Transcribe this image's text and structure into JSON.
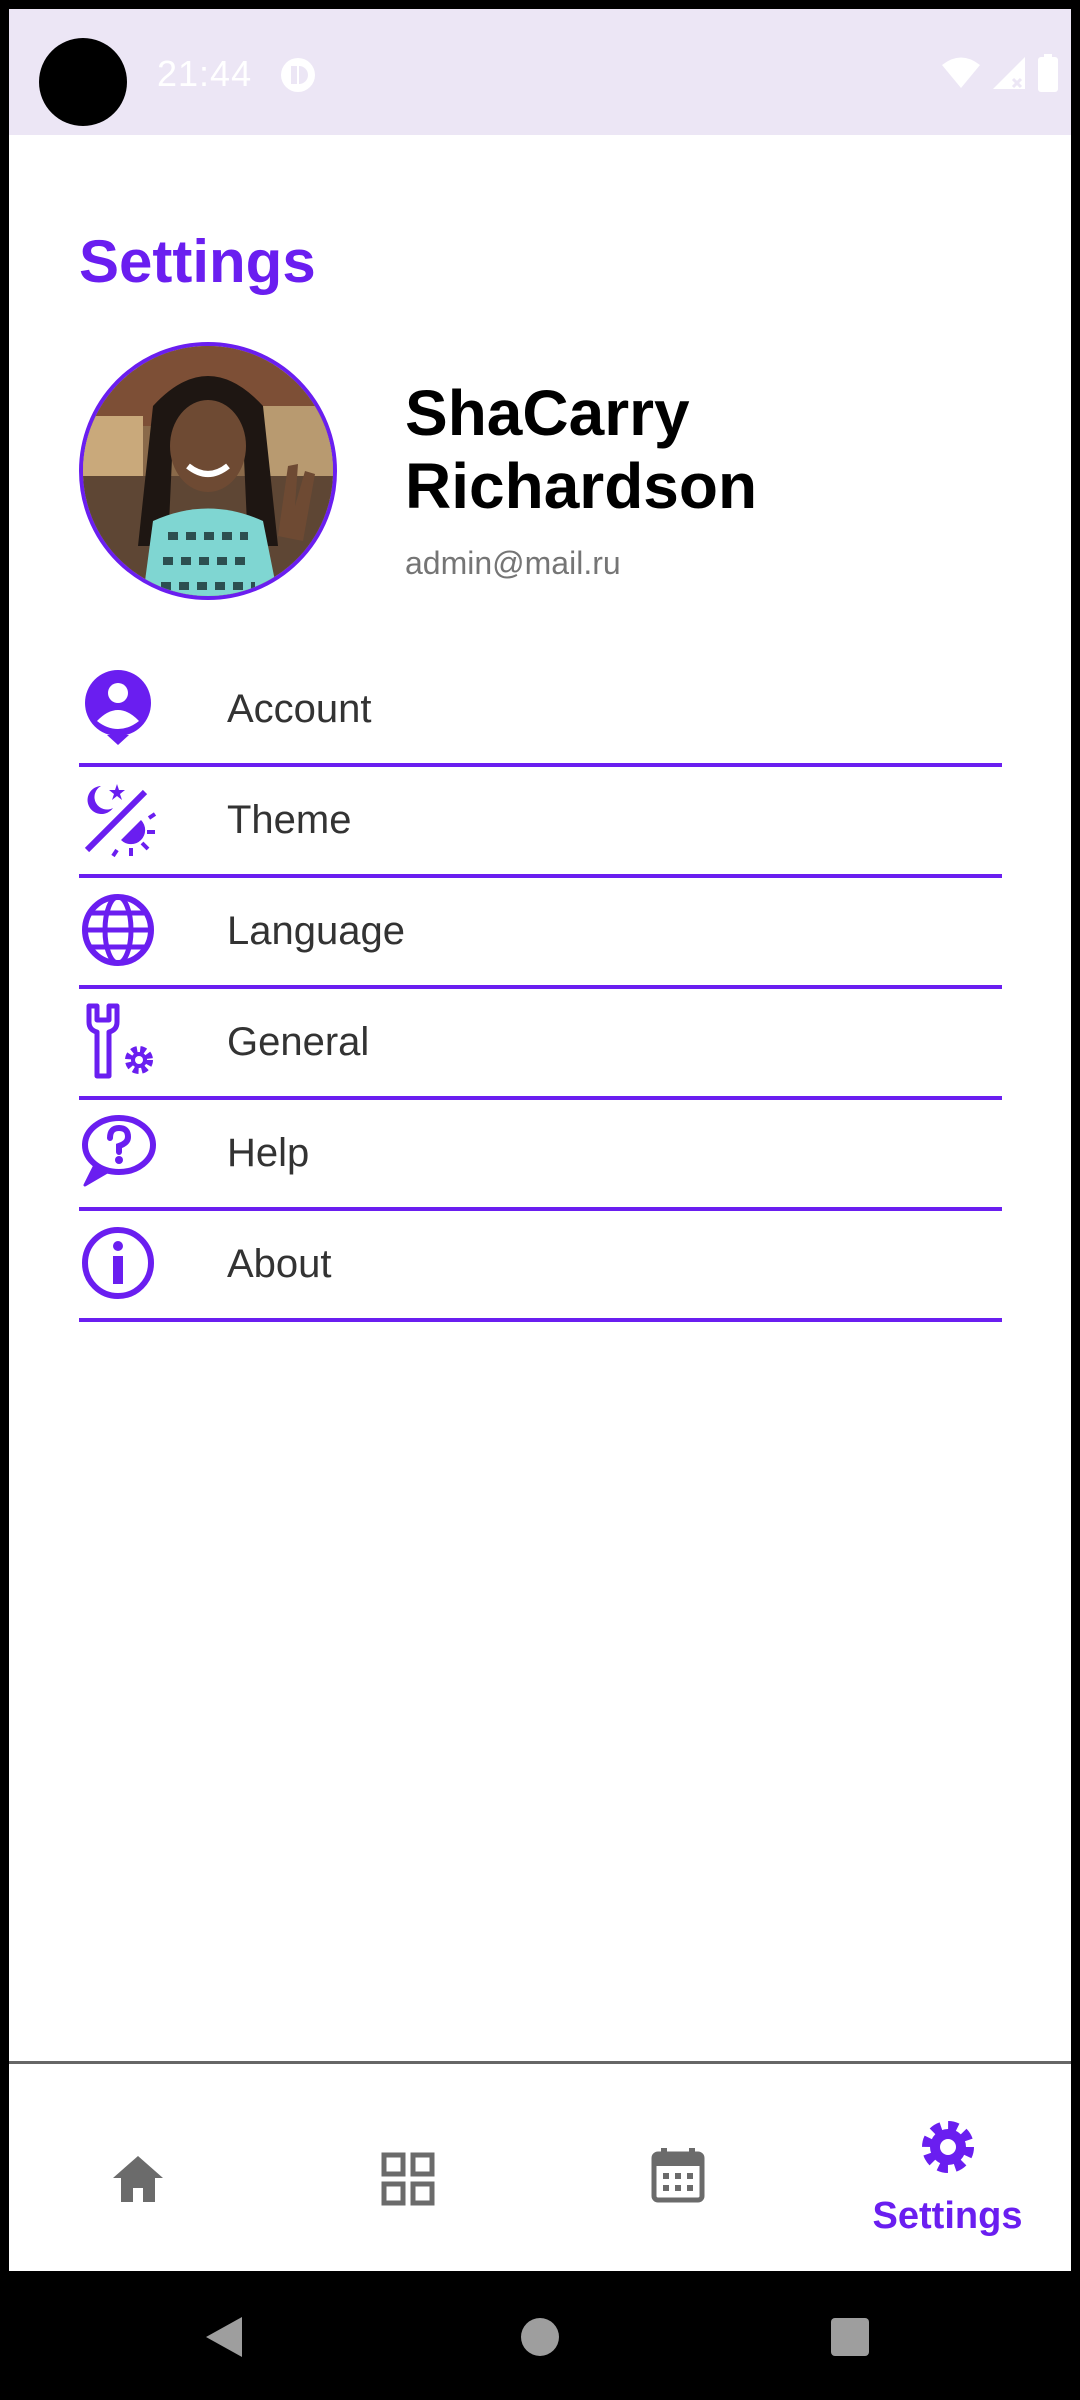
{
  "status_bar": {
    "time": "21:44",
    "icons": [
      "app-notification-icon",
      "wifi-icon",
      "signal-icon",
      "battery-icon"
    ]
  },
  "page": {
    "title": "Settings"
  },
  "profile": {
    "name": "ShaCarry Richardson",
    "email": "admin@mail.ru",
    "avatar_icon": "profile-photo"
  },
  "menu": {
    "items": [
      {
        "label": "Account",
        "icon": "account-circle-icon"
      },
      {
        "label": "Theme",
        "icon": "theme-day-night-icon"
      },
      {
        "label": "Language",
        "icon": "globe-icon"
      },
      {
        "label": "General",
        "icon": "wrench-gear-icon"
      },
      {
        "label": "Help",
        "icon": "help-bubble-icon"
      },
      {
        "label": "About",
        "icon": "info-icon"
      }
    ]
  },
  "bottom_nav": {
    "items": [
      {
        "icon": "home-icon",
        "label": ""
      },
      {
        "icon": "grid-icon",
        "label": ""
      },
      {
        "icon": "calendar-icon",
        "label": ""
      },
      {
        "icon": "gear-icon",
        "label": "Settings",
        "active": true
      }
    ]
  },
  "colors": {
    "accent": "#6a1ef0",
    "status_bar_bg": "#ece6f5",
    "inactive_icon": "#6b6b6b",
    "text_primary": "#000000",
    "text_secondary": "#757575"
  }
}
